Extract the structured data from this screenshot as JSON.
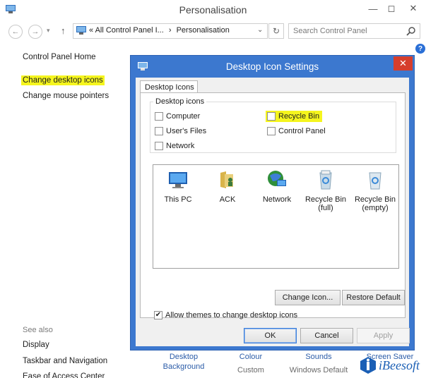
{
  "window": {
    "title": "Personalisation"
  },
  "address_bar": {
    "path_prefix": "«",
    "path": "All Control Panel I...",
    "separator": "›",
    "current": "Personalisation"
  },
  "search": {
    "placeholder": "Search Control Panel"
  },
  "sidebar": {
    "home": "Control Panel Home",
    "items": [
      "Change desktop icons",
      "Change mouse pointers"
    ],
    "highlight_color": "#f5f51e"
  },
  "see_also": {
    "heading": "See also",
    "items": [
      "Display",
      "Taskbar and Navigation",
      "Ease of Access Center"
    ]
  },
  "bottom_bar": [
    {
      "label": "Desktop",
      "sub": "Background"
    },
    {
      "label": "Colour",
      "sub": "Custom"
    },
    {
      "label": "Sounds",
      "sub": "Windows Default"
    },
    {
      "label": "Screen Saver",
      "sub": ""
    }
  ],
  "dialog": {
    "title": "Desktop Icon Settings",
    "title_bar_color": "#3c78cf",
    "close_color": "#d63e2c",
    "tab": "Desktop Icons",
    "group_label": "Desktop icons",
    "checkboxes": [
      {
        "label": "Computer",
        "checked": false
      },
      {
        "label": "User's Files",
        "checked": false
      },
      {
        "label": "Network",
        "checked": false
      },
      {
        "label": "Recycle Bin",
        "checked": false
      },
      {
        "label": "Control Panel",
        "checked": false
      }
    ],
    "icons": [
      {
        "label": "This PC",
        "icon": "computer-icon"
      },
      {
        "label": "ACK",
        "icon": "user-folder-icon"
      },
      {
        "label": "Network",
        "icon": "network-globe-icon"
      },
      {
        "label": "Recycle Bin\n(full)",
        "icon": "recycle-bin-full-icon"
      },
      {
        "label": "Recycle Bin\n(empty)",
        "icon": "recycle-bin-empty-icon"
      }
    ],
    "change_icon": "Change Icon...",
    "restore_default": "Restore Default",
    "allow_themes": {
      "label": "Allow themes to change desktop icons",
      "checked": true
    },
    "ok": "OK",
    "cancel": "Cancel",
    "apply": "Apply"
  },
  "watermark": {
    "text": "iBeesoft"
  }
}
